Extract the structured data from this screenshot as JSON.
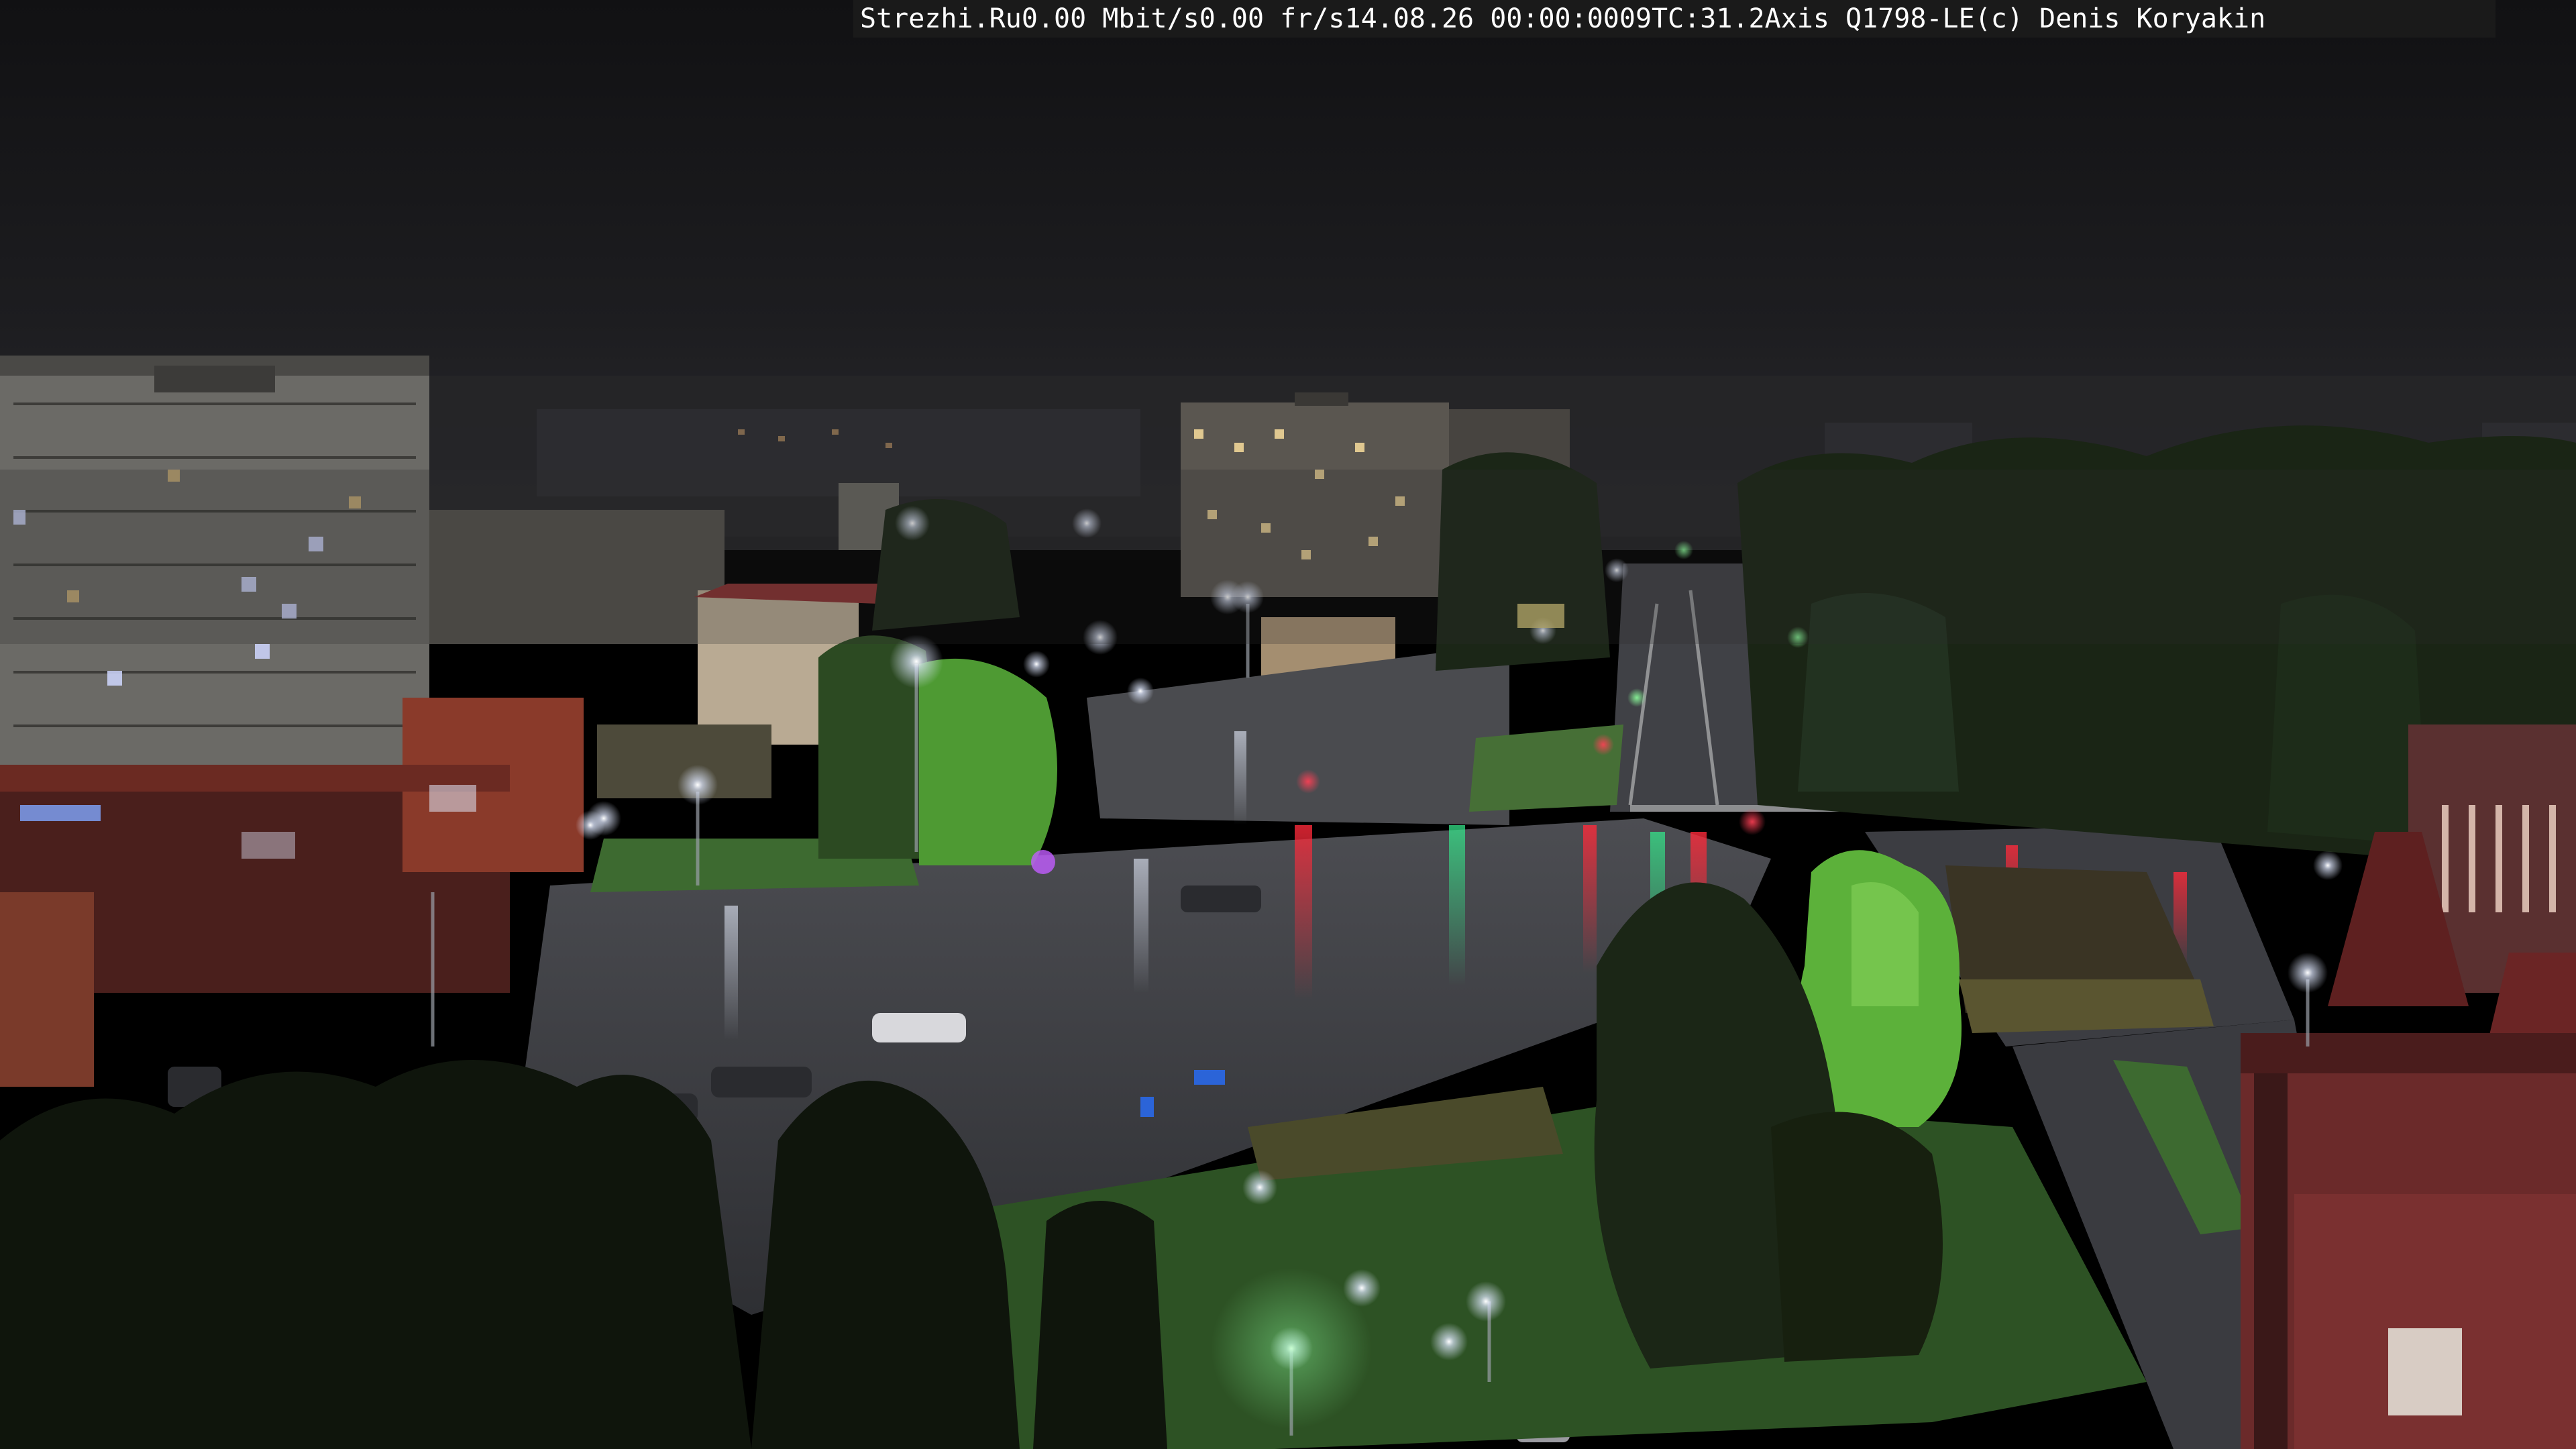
{
  "overlay": {
    "site": "Strezhi.Ru",
    "bandwidth": "0.00 Mbit/s",
    "framerate": "0.00 fr/s",
    "datetime": "14.08.26 00:00:0009",
    "tc": "TC:31.2",
    "camera": "Axis Q1798-LE",
    "copyright": "(c) Denis Koryakin"
  },
  "colors": {
    "sky": "#1c1c1e",
    "fog": "#2a2a2c",
    "asphalt_wet": "#3b3c40",
    "grass": "#2f5a26",
    "tree_dark": "#13190f",
    "tree_lit": "#5cb13a",
    "streetlight": "#e8efff",
    "traffic_red": "#ff2a3a",
    "traffic_green": "#35e58a",
    "building_brick": "#7a2c2c"
  },
  "icons": {
    "streetlamp": "streetlamp-icon",
    "traffic_light": "traffic-light-icon"
  }
}
